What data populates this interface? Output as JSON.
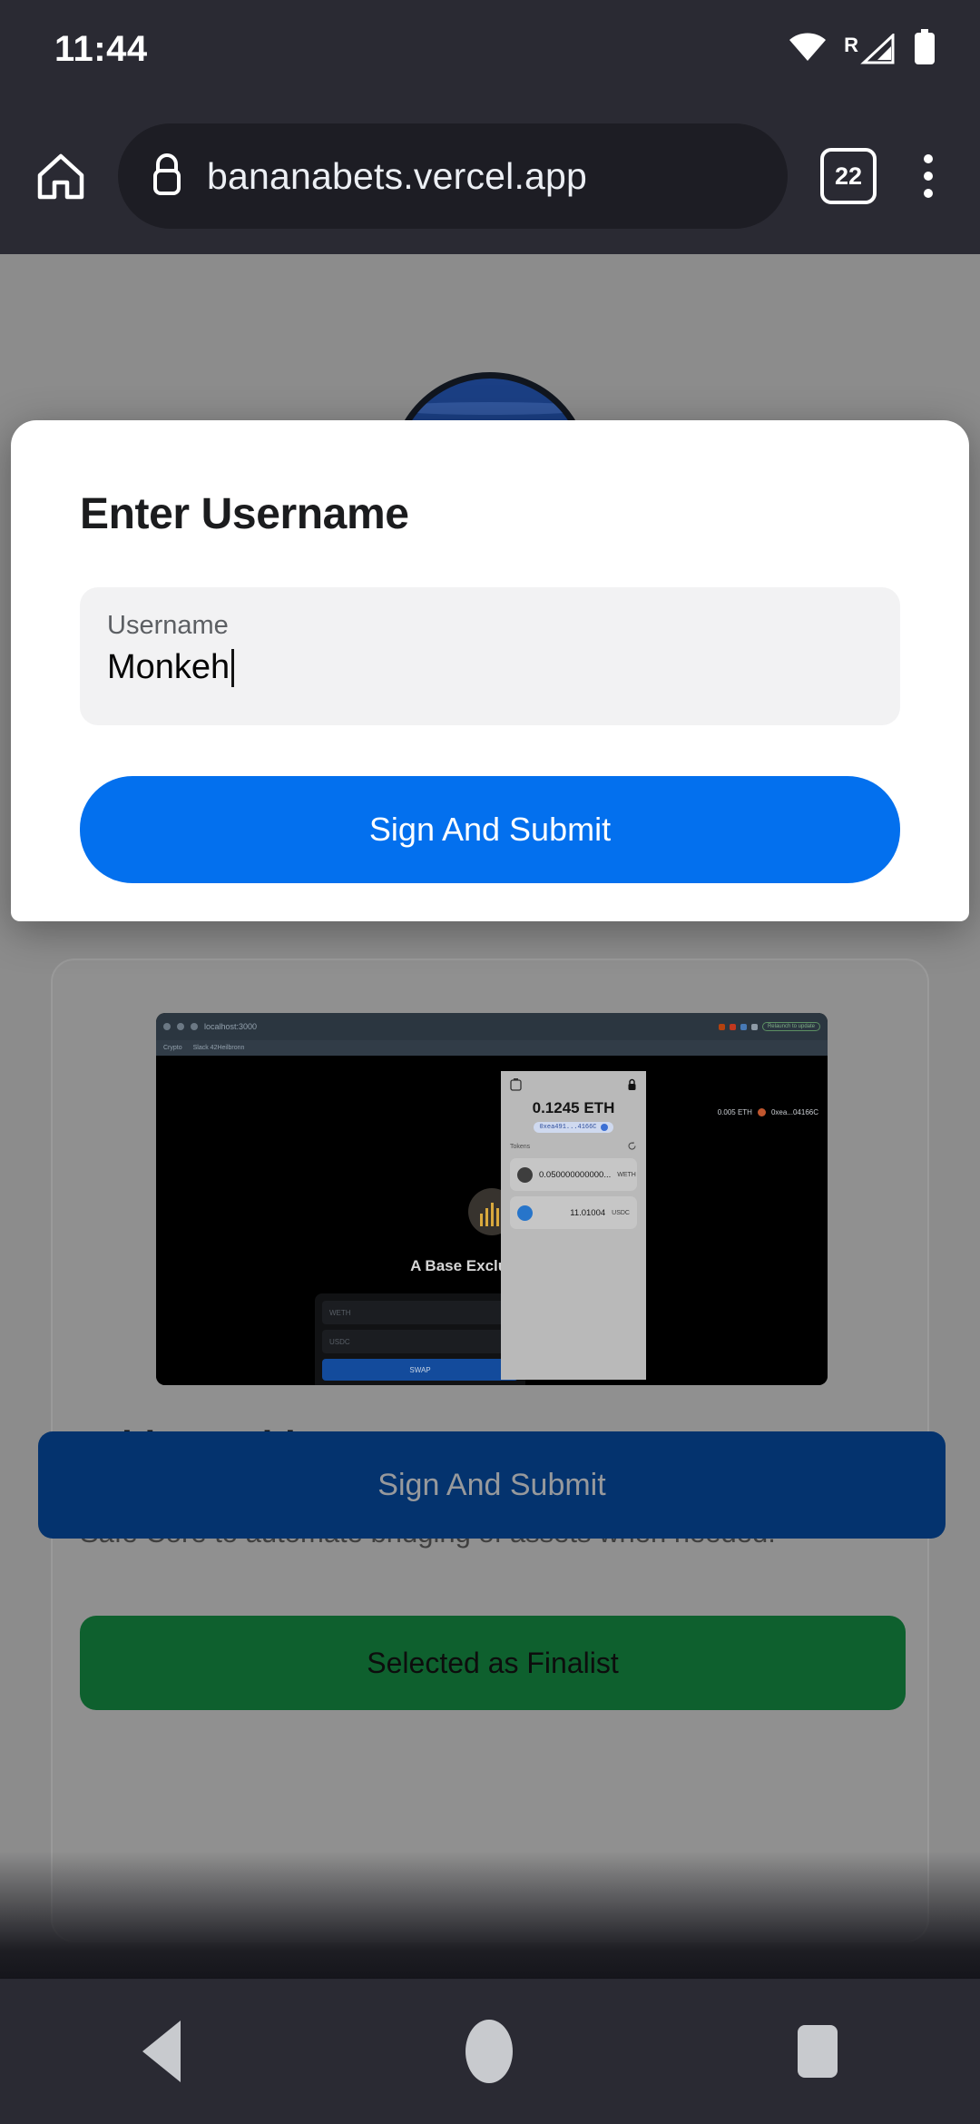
{
  "status_bar": {
    "time": "11:44",
    "icons": [
      "wifi-icon",
      "roaming-signal-icon",
      "battery-icon"
    ],
    "roaming_label": "R"
  },
  "browser": {
    "home_icon": "home-icon",
    "lock_icon": "lock-icon",
    "url": "bananabets.vercel.app",
    "tab_count": "22",
    "menu_icon": "overflow-menu-icon"
  },
  "dialog": {
    "title": "Enter Username",
    "field": {
      "label": "Username",
      "value": "Monkeh",
      "placeholder": "Username"
    },
    "submit_label": "Sign And Submit"
  },
  "page": {
    "card": {
      "title": "BridgeBuddy",
      "description": "Chain abstracted wallet, utilizing Hyperlane Warp Routes and Safe Core to automate bridging of assets when needed.",
      "status_label": "Selected as Finalist",
      "thumbnail": {
        "browser_url": "localhost:3000",
        "bookmarks": [
          "Crypto",
          "Slack 42Heilbronn"
        ],
        "relaunch_label": "Relaunch to update",
        "app_title": "A Base Exclusive DEX",
        "swap_fields": [
          "WETH",
          "USDC"
        ],
        "swap_button": "SWAP",
        "account_balance": "0.005 ETH",
        "account_address": "0xea...04166C",
        "wallet": {
          "balance": "0.1245 ETH",
          "address": "0xea491...4166C",
          "tokens_label": "Tokens",
          "refresh_icon": "refresh-icon",
          "trash_icon": "trash-icon",
          "lock_icon": "lock-icon",
          "items": [
            {
              "amount": "0.050000000000...",
              "symbol": "WETH"
            },
            {
              "amount": "11.01004",
              "symbol": "USDC"
            }
          ]
        }
      }
    },
    "bottom_button_label": "Sign And Submit"
  },
  "nav_bar": {
    "back": "back-icon",
    "home": "home-icon",
    "recents": "recents-icon"
  },
  "colors": {
    "system_chrome": "#2a2a33",
    "url_bar": "#1d1d24",
    "dialog_accent": "#0370ee",
    "finalist_green": "#0e602e",
    "bottom_button_blue": "#04336e",
    "page_scrim": "#8c8c8c",
    "field_fill": "#f2f2f3"
  }
}
